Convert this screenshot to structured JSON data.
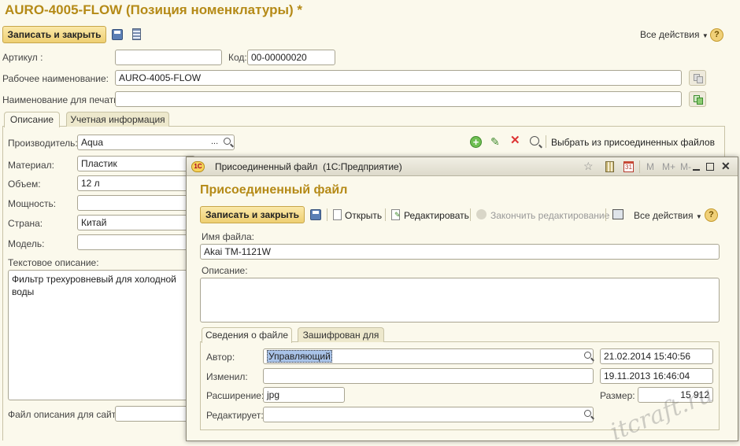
{
  "main": {
    "title": "AURO-4005-FLOW (Позиция номенклатуры) *",
    "save_close": "Записать и закрыть",
    "all_actions": "Все действия",
    "help": "?",
    "articul_label": "Артикул :",
    "articul_value": "",
    "code_label": "Код:",
    "code_value": "00-00000020",
    "work_name_label": "Рабочее наименование:",
    "work_name_value": "AURO-4005-FLOW",
    "print_name_label": "Наименование для печати:",
    "print_name_value": "",
    "tabs": [
      {
        "label": "Описание"
      },
      {
        "label": "Учетная информация"
      }
    ],
    "manufacturer_label": "Производитель:",
    "manufacturer_value": "Aqua",
    "ellipsis": "...",
    "select_from_files": "Выбрать из присоединенных файлов",
    "material_label": "Материал:",
    "material_value": "Пластик",
    "volume_label": "Объем:",
    "volume_value": "12 л",
    "power_label": "Мощность:",
    "power_value": "",
    "country_label": "Страна:",
    "country_value": "Китай",
    "model_label": "Модель:",
    "model_value": "",
    "text_desc_label": "Текстовое описание:",
    "text_desc_value": "Фильтр трехуровневый для холодной воды",
    "site_file_label": "Файл описания для сайта:"
  },
  "dialog": {
    "window_title": "Присоединенный файл  (1С:Предприятие)",
    "app_badge": "1С",
    "calendar_day": "31",
    "mem_buttons": [
      "M",
      "M+",
      "M-"
    ],
    "heading": "Присоединенный файл",
    "save_close": "Записать и закрыть",
    "open": "Открыть",
    "edit": "Редактировать",
    "finish_edit": "Закончить редактирование",
    "all_actions": "Все действия",
    "help": "?",
    "filename_label": "Имя файла:",
    "filename_value": "Akai TM-1121W",
    "description_label": "Описание:",
    "description_value": "",
    "tabs": [
      {
        "label": "Сведения о файле"
      },
      {
        "label": "Зашифрован для"
      }
    ],
    "author_label": "Автор:",
    "author_value": "Управляющий",
    "author_date": "21.02.2014 15:40:56",
    "changed_label": "Изменил:",
    "changed_value": "",
    "changed_date": "19.11.2013 16:46:04",
    "ext_label": "Расширение:",
    "ext_value": "jpg",
    "size_label": "Размер:",
    "size_value": "15 912",
    "editing_label": "Редактирует:",
    "editing_value": ""
  },
  "watermark": "itcraft.ru",
  "colors": {
    "title": "#b58a17",
    "background": "#fbf9ec",
    "button": "#f2d987",
    "selection": "#a9c3e8"
  }
}
